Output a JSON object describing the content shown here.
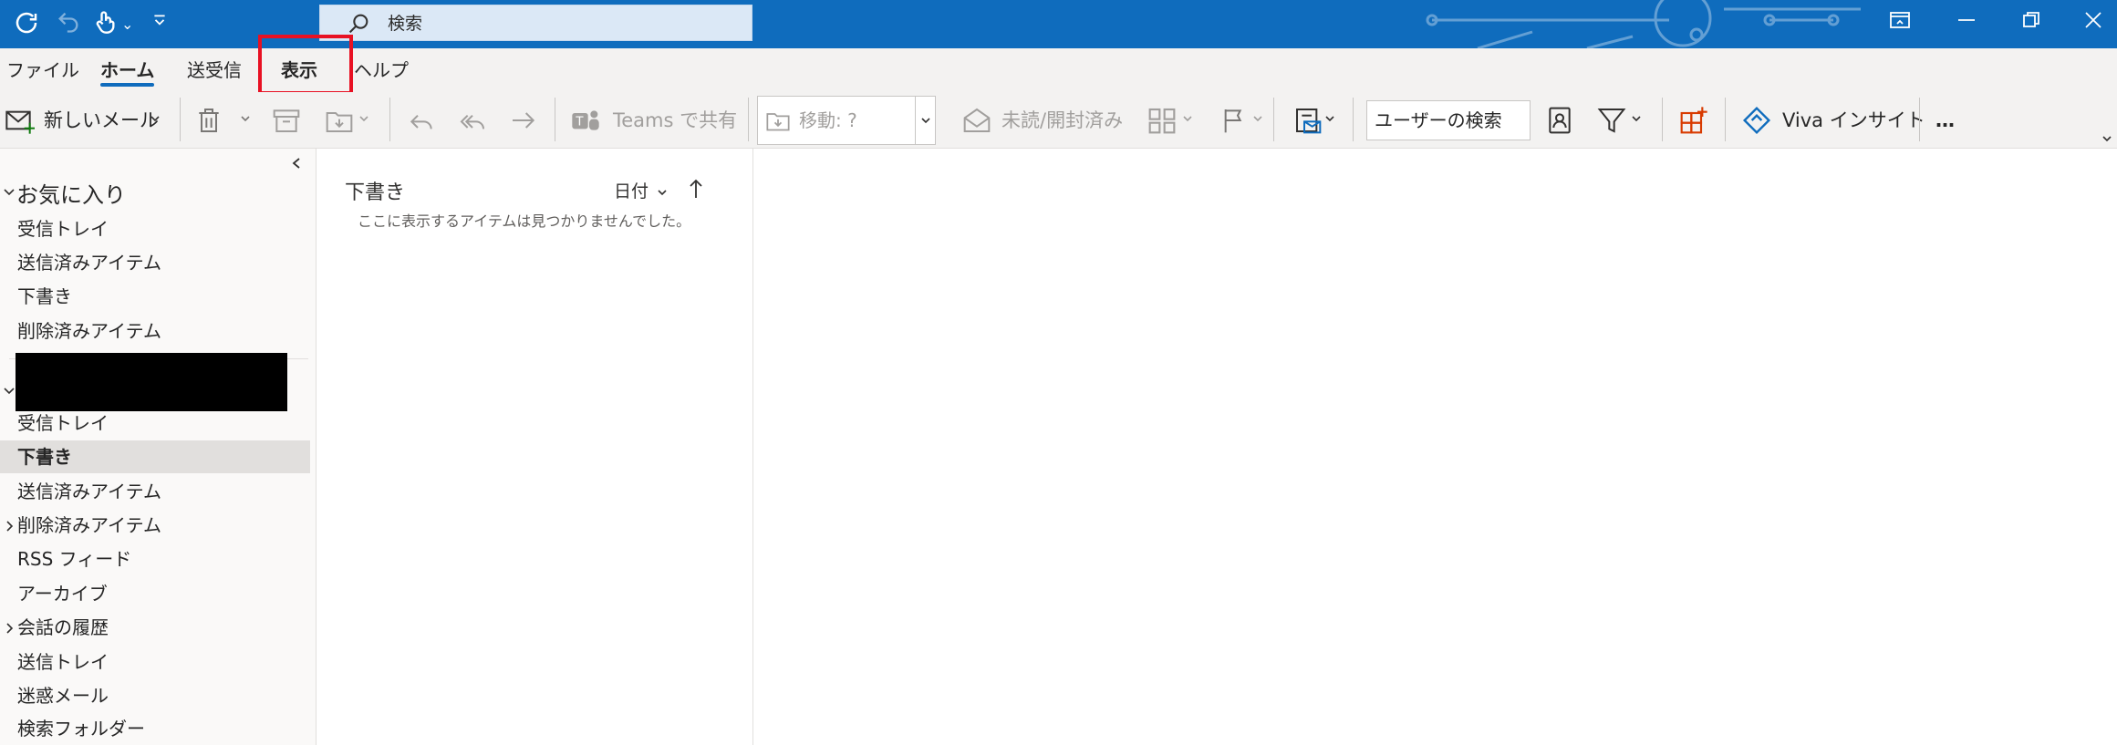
{
  "titlebar": {
    "search_placeholder": "検索",
    "accent": "#0f6cbd"
  },
  "tabs": [
    {
      "label": "ファイル"
    },
    {
      "label": "ホーム"
    },
    {
      "label": "送受信"
    },
    {
      "label": "表示"
    },
    {
      "label": "ヘルプ"
    }
  ],
  "toolbar": {
    "new_mail": "新しいメール",
    "teams_share": "Teams で共有",
    "move": "移動: ?",
    "read_unread": "未読/開封済み",
    "user_search_placeholder": "ユーザーの検索",
    "viva": "Viva インサイト",
    "more": "…"
  },
  "folders": {
    "favorites_header": "お気に入り",
    "favorites": [
      "受信トレイ",
      "送信済みアイテム",
      "下書き",
      "削除済みアイテム"
    ],
    "account_items": [
      "受信トレイ",
      "下書き",
      "送信済みアイテム",
      "削除済みアイテム",
      "RSS フィード",
      "アーカイブ",
      "会話の履歴",
      "送信トレイ",
      "迷惑メール",
      "検索フォルダー"
    ],
    "selected": "下書き"
  },
  "messagelist": {
    "folder_title": "下書き",
    "sort_label": "日付",
    "empty_message": "ここに表示するアイテムは見つかりませんでした。"
  }
}
